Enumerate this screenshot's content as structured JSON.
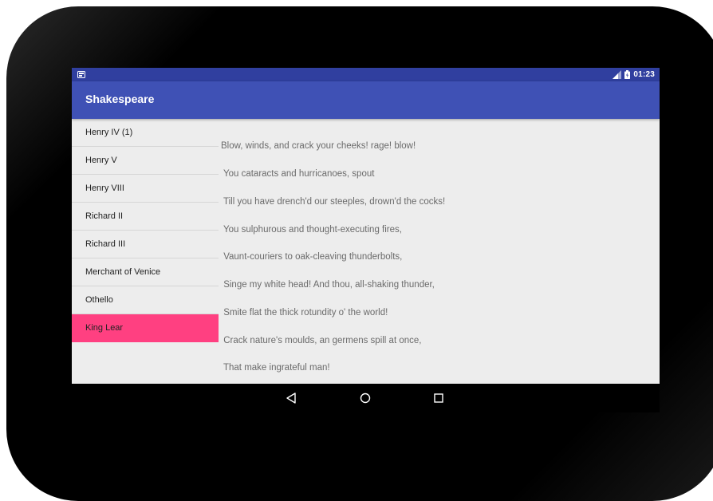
{
  "status_bar": {
    "time": "01:23",
    "left_icon": "notification-icon",
    "right_icons": [
      "signal-icon",
      "battery-icon"
    ]
  },
  "app_bar": {
    "title": "Shakespeare"
  },
  "plays": [
    {
      "label": "Henry IV (1)",
      "selected": false
    },
    {
      "label": "Henry V",
      "selected": false
    },
    {
      "label": "Henry VIII",
      "selected": false
    },
    {
      "label": "Richard II",
      "selected": false
    },
    {
      "label": "Richard III",
      "selected": false
    },
    {
      "label": "Merchant of Venice",
      "selected": false
    },
    {
      "label": "Othello",
      "selected": false
    },
    {
      "label": "King Lear",
      "selected": true
    }
  ],
  "quote": {
    "lines": [
      "Blow, winds, and crack your cheeks! rage! blow!",
      " You cataracts and hurricanoes, spout",
      " Till you have drench'd our steeples, drown'd the cocks!",
      " You sulphurous and thought-executing fires,",
      " Vaunt-couriers to oak-cleaving thunderbolts,",
      " Singe my white head! And thou, all-shaking thunder,",
      " Smite flat the thick rotundity o' the world!",
      " Crack nature's moulds, an germens spill at once,",
      " That make ingrateful man!"
    ]
  },
  "nav_bar": {
    "buttons": [
      "back-icon",
      "home-icon",
      "recents-icon"
    ]
  },
  "colors": {
    "status_bar": "#303f9f",
    "app_bar": "#3f51b5",
    "selected_item": "#ff4081",
    "background": "#ededed"
  }
}
